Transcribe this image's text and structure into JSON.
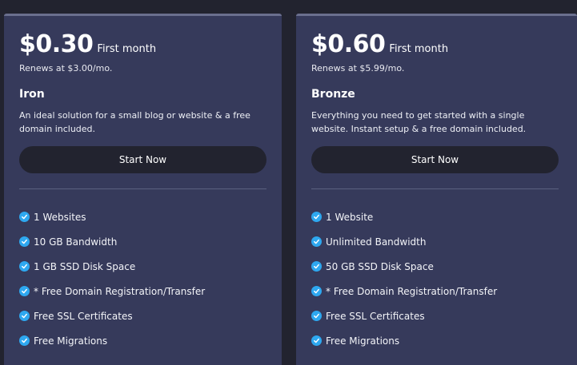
{
  "colors": {
    "page_bg": "#22232f",
    "card_bg": "#363a5b",
    "check": "#2ea8f0"
  },
  "plans": [
    {
      "price": "$0.30",
      "price_suffix": "First month",
      "renews": "Renews at $3.00/mo.",
      "name": "Iron",
      "description": "An ideal solution for a small blog or website & a free domain included.",
      "cta": "Start Now",
      "features": [
        "1 Websites",
        "10 GB Bandwidth",
        "1 GB SSD Disk Space",
        "* Free Domain Registration/Transfer",
        "Free SSL Certificates",
        "Free Migrations"
      ]
    },
    {
      "price": "$0.60",
      "price_suffix": "First month",
      "renews": "Renews at $5.99/mo.",
      "name": "Bronze",
      "description": "Everything you need to get started with a single website. Instant setup & a free domain included.",
      "cta": "Start Now",
      "features": [
        "1 Website",
        "Unlimited Bandwidth",
        "50 GB SSD Disk Space",
        "* Free Domain Registration/Transfer",
        "Free SSL Certificates",
        "Free Migrations"
      ]
    }
  ]
}
